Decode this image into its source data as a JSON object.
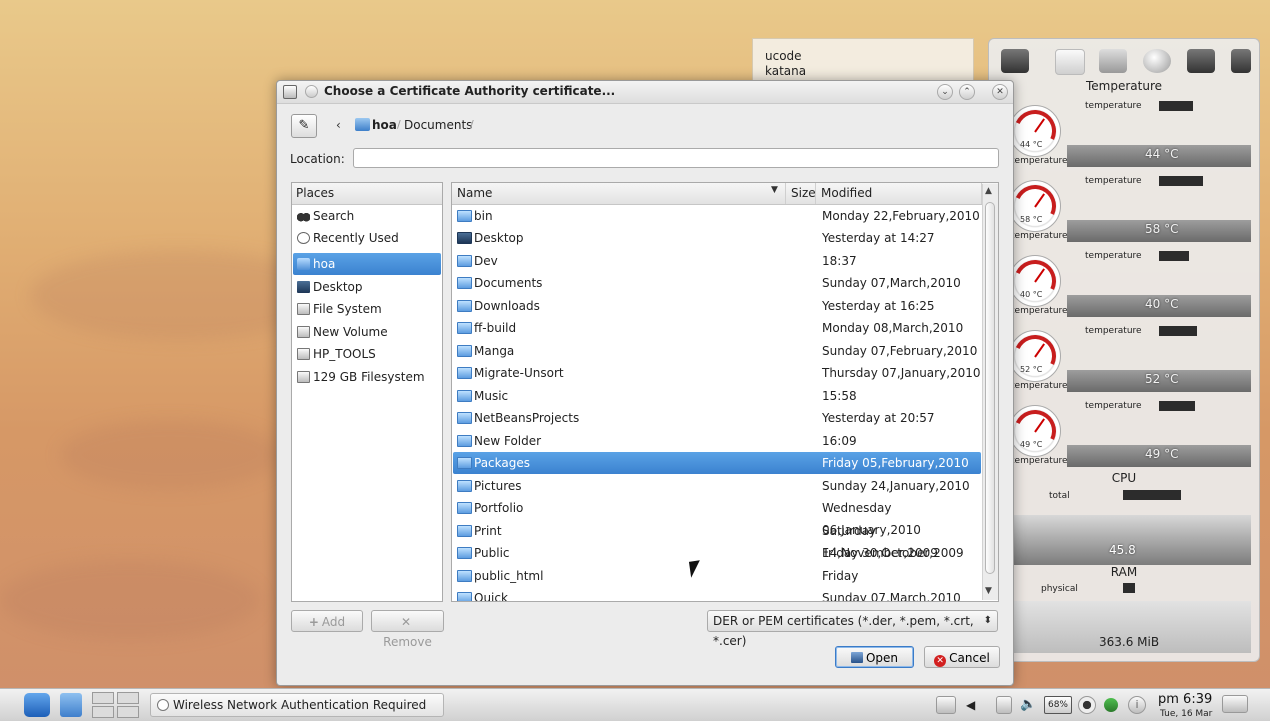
{
  "sticky_note": {
    "lines": [
      "ucode",
      "katana"
    ]
  },
  "monitor": {
    "temperature_title": "Temperature",
    "sensor_label": "temperature",
    "gauge_sub_label": "temperature",
    "sensors": [
      {
        "gauge": "44 °C",
        "value": "44 °C"
      },
      {
        "gauge": "58 °C",
        "value": "58 °C"
      },
      {
        "gauge": "40 °C",
        "value": "40 °C"
      },
      {
        "gauge": "52 °C",
        "value": "52 °C"
      },
      {
        "gauge": "49 °C",
        "value": "49 °C"
      }
    ],
    "cpu_title": "CPU",
    "cpu_label": "total",
    "cpu_value": "45.8",
    "ram_title": "RAM",
    "ram_label": "physical",
    "ram_value": "363.6 MiB"
  },
  "dialog": {
    "title": "Choose a Certificate Authority certificate...",
    "nav_back": "‹",
    "breadcrumb": [
      "hoa",
      "Documents"
    ],
    "location_label": "Location:",
    "location_value": "",
    "places_header": "Places",
    "places": [
      {
        "label": "Search",
        "icon": "binoculars-icon"
      },
      {
        "label": "Recently Used",
        "icon": "clock-icon"
      },
      {
        "label": "hoa",
        "icon": "home-folder-icon",
        "selected": true
      },
      {
        "label": "Desktop",
        "icon": "desktop-icon"
      },
      {
        "label": "File System",
        "icon": "drive-icon"
      },
      {
        "label": "New Volume",
        "icon": "drive-icon"
      },
      {
        "label": "HP_TOOLS",
        "icon": "drive-icon"
      },
      {
        "label": "129 GB Filesystem",
        "icon": "drive-icon"
      }
    ],
    "columns": {
      "name": "Name",
      "size": "Size",
      "modified": "Modified"
    },
    "files": [
      {
        "name": "bin",
        "modified": "Monday 22,February,2010"
      },
      {
        "name": "Desktop",
        "modified": "Yesterday at 14:27",
        "icon": "desktop"
      },
      {
        "name": "Dev",
        "modified": "18:37"
      },
      {
        "name": "Documents",
        "modified": "Sunday 07,March,2010"
      },
      {
        "name": "Downloads",
        "modified": "Yesterday at 16:25"
      },
      {
        "name": "ff-build",
        "modified": "Monday 08,March,2010"
      },
      {
        "name": "Manga",
        "modified": "Sunday 07,February,2010"
      },
      {
        "name": "Migrate-Unsort",
        "modified": "Thursday 07,January,2010"
      },
      {
        "name": "Music",
        "modified": "15:58"
      },
      {
        "name": "NetBeansProjects",
        "modified": "Yesterday at 20:57"
      },
      {
        "name": "New Folder",
        "modified": "16:09"
      },
      {
        "name": "Packages",
        "modified": "Friday 05,February,2010",
        "selected": true
      },
      {
        "name": "Pictures",
        "modified": "Sunday 24,January,2010"
      },
      {
        "name": "Portfolio",
        "modified": "Wednesday 06,January,2010"
      },
      {
        "name": "Print",
        "modified": "Saturday 14,November,2009"
      },
      {
        "name": "Public",
        "modified": "Friday 30,October,2009"
      },
      {
        "name": "public_html",
        "modified": "Friday"
      },
      {
        "name": "Quick",
        "modified": "Sunday 07,March,2010"
      }
    ],
    "add_label": "Add",
    "remove_label": "Remove",
    "filter_value": "DER or PEM certificates (*.der, *.pem, *.crt, *.cer)",
    "open_label": "Open",
    "cancel_label": "Cancel"
  },
  "taskbar": {
    "task_label": "Wireless Network Authentication Required",
    "battery": "68%",
    "time": "pm 6:39",
    "date": "Tue, 16 Mar"
  }
}
